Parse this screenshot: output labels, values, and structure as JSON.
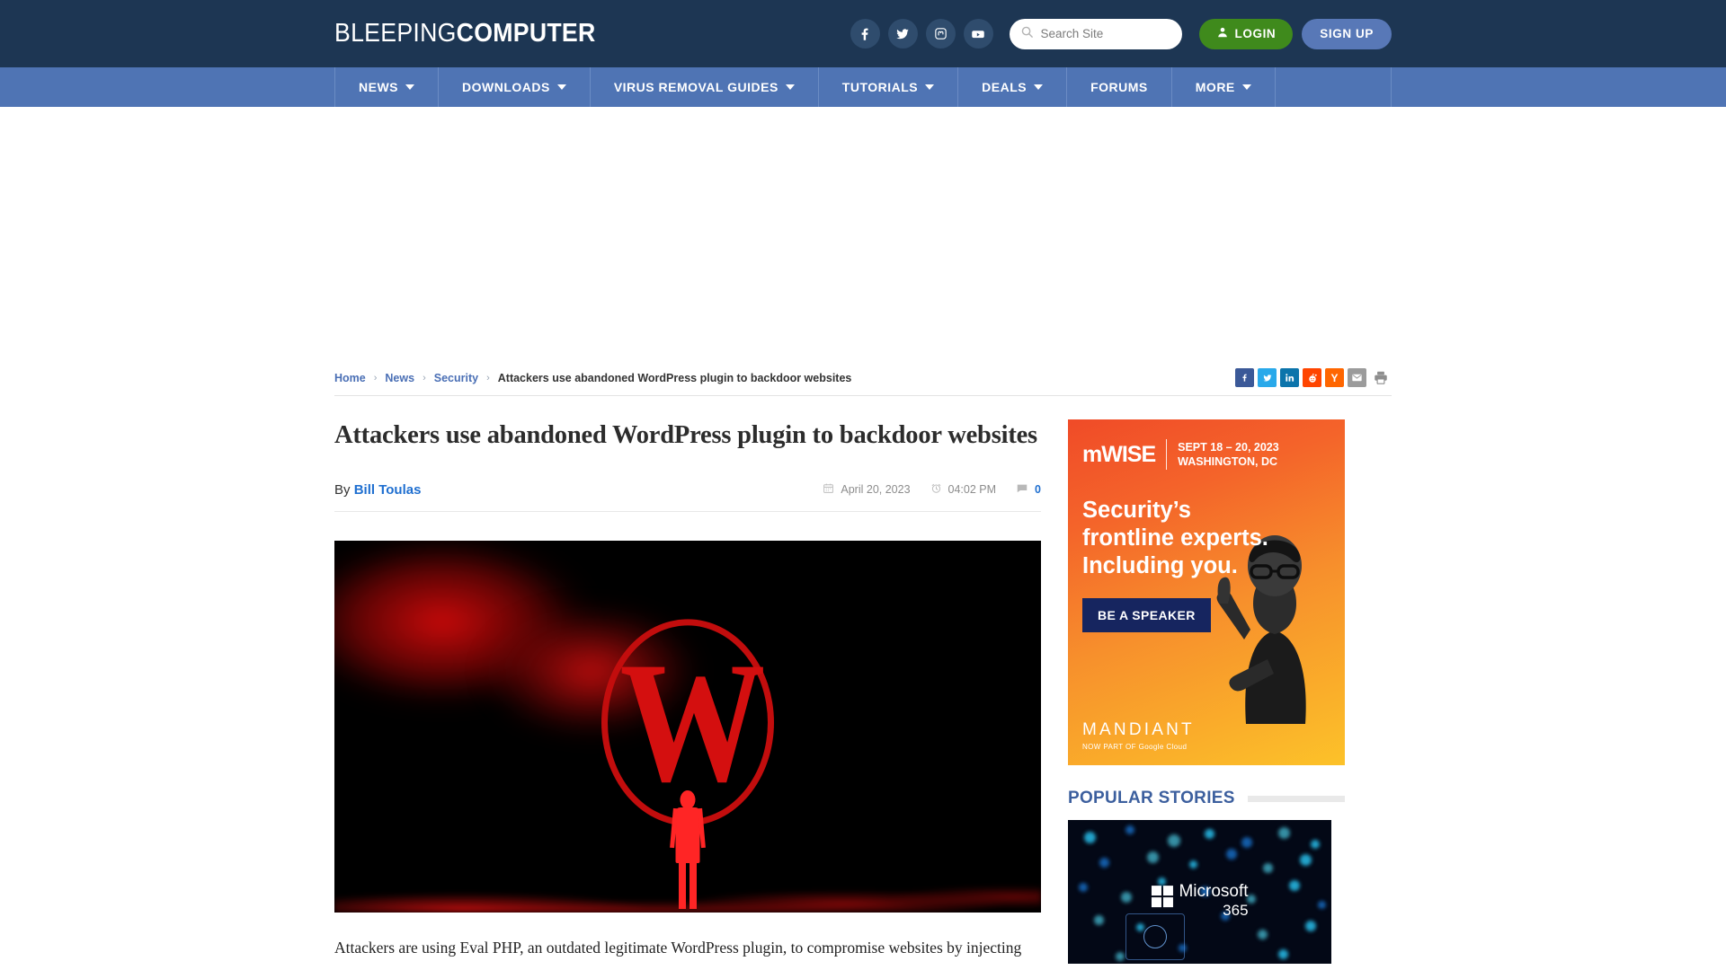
{
  "header": {
    "logo_thin": "BLEEPING",
    "logo_bold": "COMPUTER",
    "social": [
      {
        "name": "facebook-icon",
        "label": "Facebook"
      },
      {
        "name": "twitter-icon",
        "label": "Twitter"
      },
      {
        "name": "mastodon-icon",
        "label": "Mastodon"
      },
      {
        "name": "youtube-icon",
        "label": "YouTube"
      }
    ],
    "search": {
      "placeholder": "Search Site",
      "value": ""
    },
    "login_label": "LOGIN",
    "signup_label": "SIGN UP",
    "colors": {
      "header_bg": "#1d3653",
      "nav_bg": "#4f74b4",
      "login_green": "#3f8a1c",
      "signup_blue": "#5878b7"
    }
  },
  "nav": {
    "items": [
      {
        "label": "NEWS",
        "has_caret": true
      },
      {
        "label": "DOWNLOADS",
        "has_caret": true
      },
      {
        "label": "VIRUS REMOVAL GUIDES",
        "has_caret": true
      },
      {
        "label": "TUTORIALS",
        "has_caret": true
      },
      {
        "label": "DEALS",
        "has_caret": true
      },
      {
        "label": "FORUMS",
        "has_caret": false
      },
      {
        "label": "MORE",
        "has_caret": true
      }
    ]
  },
  "breadcrumb": {
    "items": [
      {
        "label": "Home",
        "link": true
      },
      {
        "label": "News",
        "link": true
      },
      {
        "label": "Security",
        "link": true
      },
      {
        "label": "Attackers use abandoned WordPress plugin to backdoor websites",
        "link": false
      }
    ],
    "separator": "›"
  },
  "share": [
    {
      "name": "share-facebook",
      "glyph": "f",
      "cls": "sh-fb"
    },
    {
      "name": "share-twitter",
      "glyph": "",
      "cls": "sh-tw"
    },
    {
      "name": "share-linkedin",
      "glyph": "in",
      "cls": "sh-li"
    },
    {
      "name": "share-reddit",
      "glyph": "",
      "cls": "sh-rd"
    },
    {
      "name": "share-hackernews",
      "glyph": "Y",
      "cls": "sh-hn"
    },
    {
      "name": "share-email",
      "glyph": "",
      "cls": "sh-ml"
    },
    {
      "name": "share-print",
      "glyph": "",
      "cls": "sh-pr"
    }
  ],
  "article": {
    "title": "Attackers use abandoned WordPress plugin to backdoor websites",
    "by_prefix": "By",
    "author": "Bill Toulas",
    "date": "April 20, 2023",
    "time": "04:02 PM",
    "comment_count": "0",
    "body_text": "Attackers are using Eval PHP, an outdated legitimate WordPress plugin, to compromise websites by injecting"
  },
  "sidebar": {
    "ad": {
      "logo": "mWISE",
      "dates_line1": "SEPT 18 – 20, 2023",
      "dates_line2": "WASHINGTON, DC",
      "headline_line1": "Security’s",
      "headline_line2": "frontline experts.",
      "headline_line3": "Including you.",
      "cta_label": "BE A SPEAKER",
      "brand": "MANDIANT",
      "brand_sub": "NOW PART OF Google Cloud"
    },
    "popular_stories_title": "POPULAR STORIES",
    "story_thumb": {
      "brand": "Microsoft",
      "product": "365"
    }
  }
}
